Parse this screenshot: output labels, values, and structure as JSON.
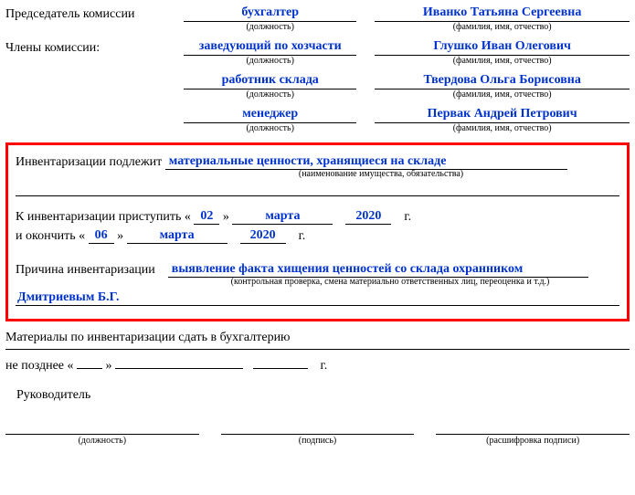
{
  "header": {
    "chair_label": "Председатель комиссии",
    "members_label": "Члены комиссии:",
    "caption_position": "(должность)",
    "caption_name": "(фамилия, имя, отчество)",
    "members": [
      {
        "position": "бухгалтер",
        "name": "Иванко Татьяна Сергеевна"
      },
      {
        "position": "заведующий по хозчасти",
        "name": "Глушко Иван Олегович"
      },
      {
        "position": "работник склада",
        "name": "Твердова Ольга Борисовна"
      },
      {
        "position": "менеджер",
        "name": "Первак Андрей Петрович"
      }
    ]
  },
  "box": {
    "subject_label": "Инвентаризации подлежит",
    "subject_value": "материальные ценности, хранящиеся на складе",
    "subject_caption": "(наименование имущества, обязательства)",
    "start_label": "К инвентаризации приступить «",
    "start_day": "02",
    "start_month": "марта",
    "start_year": "2020",
    "year_suffix": "г.",
    "end_label": "и окончить «",
    "end_day": "06",
    "end_month": "марта",
    "end_year": "2020",
    "quote_close": "»",
    "reason_label": "Причина инвентаризации",
    "reason_value": "выявление факта хищения ценностей со склада охранником",
    "reason_caption": "(контрольная проверка, смена материально ответственных лиц, переоценка и т.д.)",
    "reason_value2": "Дмитриевым Б.Г."
  },
  "footer": {
    "deliver_label": "Материалы по инвентаризации сдать в бухгалтерию",
    "deadline_prefix": "не позднее «",
    "deadline_day": "",
    "deadline_month": "",
    "deadline_year": "",
    "leader_label": "Руководитель",
    "sig_cap_position": "(должность)",
    "sig_cap_sign": "(подпись)",
    "sig_cap_decipher": "(расшифровка подписи)"
  }
}
